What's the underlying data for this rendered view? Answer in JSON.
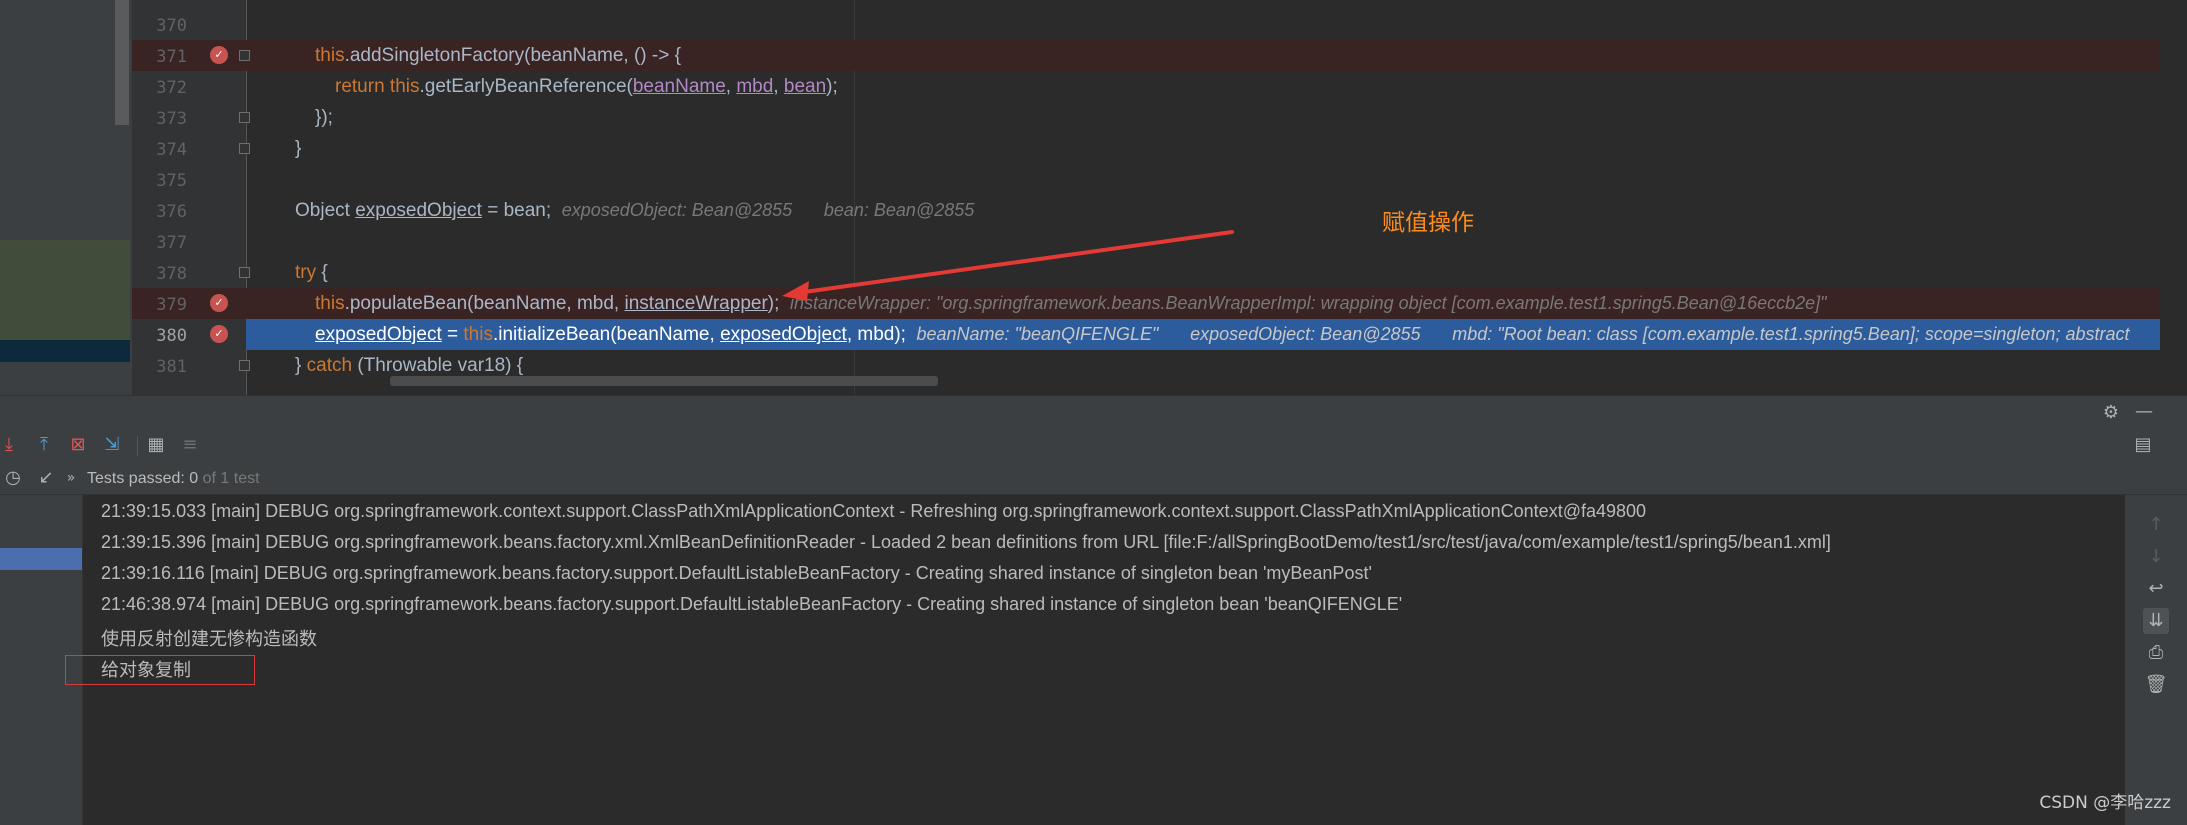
{
  "editor": {
    "lines": [
      {
        "num": "370"
      },
      {
        "num": "371"
      },
      {
        "num": "372"
      },
      {
        "num": "373"
      },
      {
        "num": "374"
      },
      {
        "num": "375"
      },
      {
        "num": "376"
      },
      {
        "num": "377"
      },
      {
        "num": "378"
      },
      {
        "num": "379"
      },
      {
        "num": "380"
      },
      {
        "num": "381"
      }
    ],
    "code": {
      "l371_this": "this",
      "l371_rest": ".addSingletonFactory(beanName, () -> {",
      "l372_return": "return ",
      "l372_this": "this",
      "l372_method": ".getEarlyBeanReference(",
      "l372_p1": "beanName",
      "l372_sep1": ", ",
      "l372_p2": "mbd",
      "l372_sep2": ", ",
      "l372_p3": "bean",
      "l372_end": ");",
      "l373": "});",
      "l374": "}",
      "l376_type": "Object ",
      "l376_var": "exposedObject",
      "l376_rest": " = bean;",
      "l376_hint1": "exposedObject: Bean@2855",
      "l376_hint2": "bean: Bean@2855",
      "l378_try": "try",
      "l378_brace": " {",
      "l379_this": "this",
      "l379_rest": ".populateBean(beanName, mbd, ",
      "l379_var": "instanceWrapper",
      "l379_end": ");",
      "l379_hint": "instanceWrapper: \"org.springframework.beans.BeanWrapperImpl: wrapping object [com.example.test1.spring5.Bean@16eccb2e]\"",
      "l380_var": "exposedObject",
      "l380_eq": " = ",
      "l380_this": "this",
      "l380_method": ".initializeBean(beanName, ",
      "l380_arg": "exposedObject",
      "l380_end": ", mbd);",
      "l380_hint1": "beanName: \"beanQIFENGLE\"",
      "l380_hint2": "exposedObject: Bean@2855",
      "l380_hint3": "mbd: \"Root bean: class [com.example.test1.spring5.Bean]; scope=singleton; abstract",
      "l381_open": "} ",
      "l381_catch": "catch",
      "l381_rest": " (Throwable var18) {"
    },
    "annotation": "赋值操作",
    "colors": {
      "breakpoint_line": "#3a2323",
      "current_line": "#2d5c9c",
      "annotation": "#ff8c1a",
      "arrow": "#e53935"
    }
  },
  "run": {
    "toolbar_icons": [
      "import-tests-icon",
      "export-tests-icon",
      "rerun-failed-icon",
      "sort-icon",
      "table-icon",
      "settings-list-icon"
    ],
    "status": {
      "label": "Tests passed: ",
      "passed": "0",
      "of": " of 1 test"
    },
    "console_lines": [
      "21:39:15.033 [main] DEBUG org.springframework.context.support.ClassPathXmlApplicationContext - Refreshing org.springframework.context.support.ClassPathXmlApplicationContext@fa49800",
      "21:39:15.396 [main] DEBUG org.springframework.beans.factory.xml.XmlBeanDefinitionReader - Loaded 2 bean definitions from URL [file:F:/allSpringBootDemo/test1/src/test/java/com/example/test1/spring5/bean1.xml]",
      "21:39:16.116 [main] DEBUG org.springframework.beans.factory.support.DefaultListableBeanFactory - Creating shared instance of singleton bean 'myBeanPost'",
      "21:46:38.974 [main] DEBUG org.springframework.beans.factory.support.DefaultListableBeanFactory - Creating shared instance of singleton bean 'beanQIFENGLE'",
      "使用反射创建无惨构造函数",
      "给对象复制"
    ]
  },
  "watermark": "CSDN @李哈zzz"
}
